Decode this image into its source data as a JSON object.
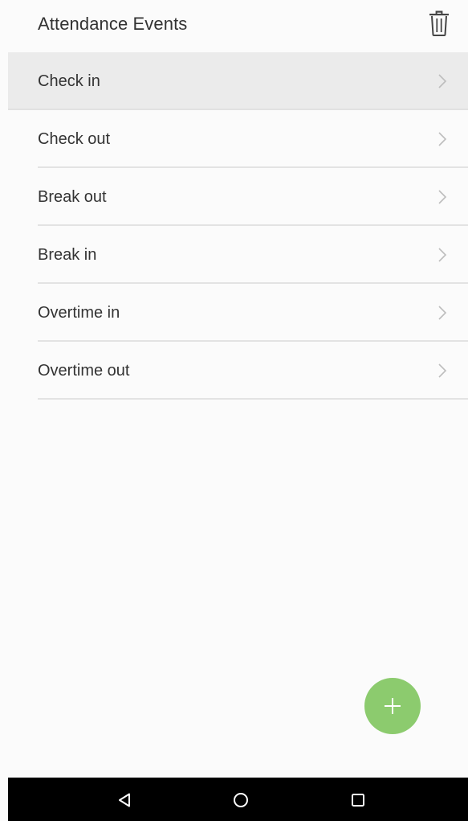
{
  "header": {
    "title": "Attendance Events",
    "delete_icon": "trash-icon"
  },
  "events": [
    {
      "label": "Check in",
      "selected": true
    },
    {
      "label": "Check out",
      "selected": false
    },
    {
      "label": "Break out",
      "selected": false
    },
    {
      "label": "Break in",
      "selected": false
    },
    {
      "label": "Overtime in",
      "selected": false
    },
    {
      "label": "Overtime out",
      "selected": false
    }
  ],
  "fab": {
    "icon": "plus-icon",
    "color": "#8ccb6e"
  },
  "navbar": {
    "back_icon": "back-triangle-icon",
    "home_icon": "home-circle-icon",
    "recents_icon": "recents-square-icon"
  },
  "colors": {
    "selected_row_bg": "#ebebeb",
    "navbar_bg": "#000000",
    "text": "#333333"
  }
}
